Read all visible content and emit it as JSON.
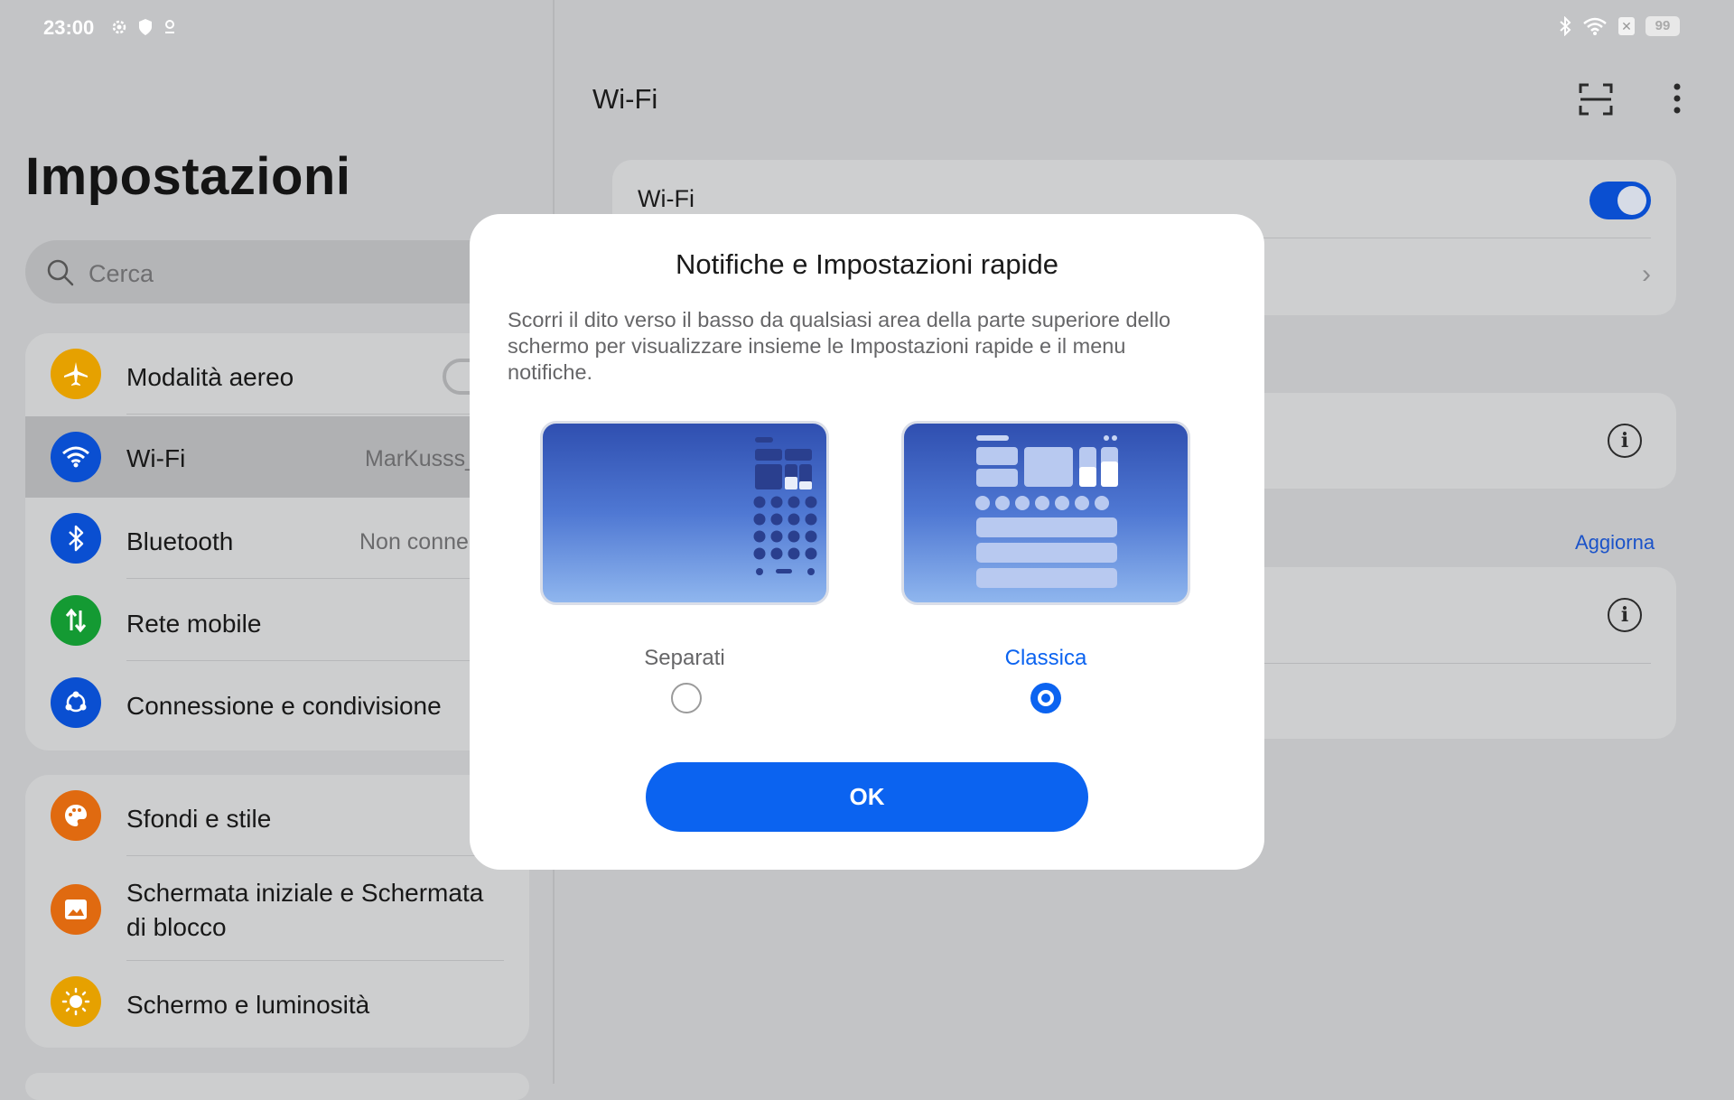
{
  "status_bar": {
    "time": "23:00",
    "left_icons": [
      "gear-icon",
      "shield-icon",
      "location-icon"
    ],
    "right_icons": [
      "bluetooth-icon",
      "wifi-signal-icon",
      "sim-x-icon"
    ],
    "battery": "99"
  },
  "sidebar": {
    "title": "Impostazioni",
    "search_placeholder": "Cerca",
    "group1": [
      {
        "label": "Modalità aereo",
        "value": "",
        "icon": "airplane-icon",
        "color": "#e6a100"
      },
      {
        "label": "Wi-Fi",
        "value": "MarKusss_",
        "icon": "wifi-icon",
        "color": "#0a4fd1"
      },
      {
        "label": "Bluetooth",
        "value": "Non conne",
        "icon": "bluetooth-icon",
        "color": "#0a4fd1"
      },
      {
        "label": "Rete mobile",
        "value": "",
        "icon": "mobile-data-icon",
        "color": "#149a33"
      },
      {
        "label": "Connessione e condivisione",
        "value": "",
        "icon": "share-icon",
        "color": "#0a4fd1"
      }
    ],
    "group2": [
      {
        "label": "Sfondi e stile",
        "icon": "palette-icon",
        "color": "#e06a10"
      },
      {
        "label": "Schermata iniziale e Schermata di blocco",
        "icon": "lockscreen-icon",
        "color": "#e06a10"
      },
      {
        "label": "Schermo e luminosità",
        "icon": "brightness-icon",
        "color": "#e6a100"
      }
    ]
  },
  "main": {
    "title": "Wi-Fi",
    "wifi_toggle_label": "Wi-Fi",
    "wifi_toggle_on": true,
    "refresh_label": "Aggiorna"
  },
  "dialog": {
    "title": "Notifiche e Impostazioni rapide",
    "description": "Scorri il dito verso il basso da qualsiasi area della parte superiore dello schermo per visualizzare insieme le Impostazioni rapide e il menu notifiche.",
    "options": [
      {
        "label": "Separati",
        "selected": false
      },
      {
        "label": "Classica",
        "selected": true
      }
    ],
    "ok_label": "OK",
    "accent_color": "#0b63f0"
  }
}
